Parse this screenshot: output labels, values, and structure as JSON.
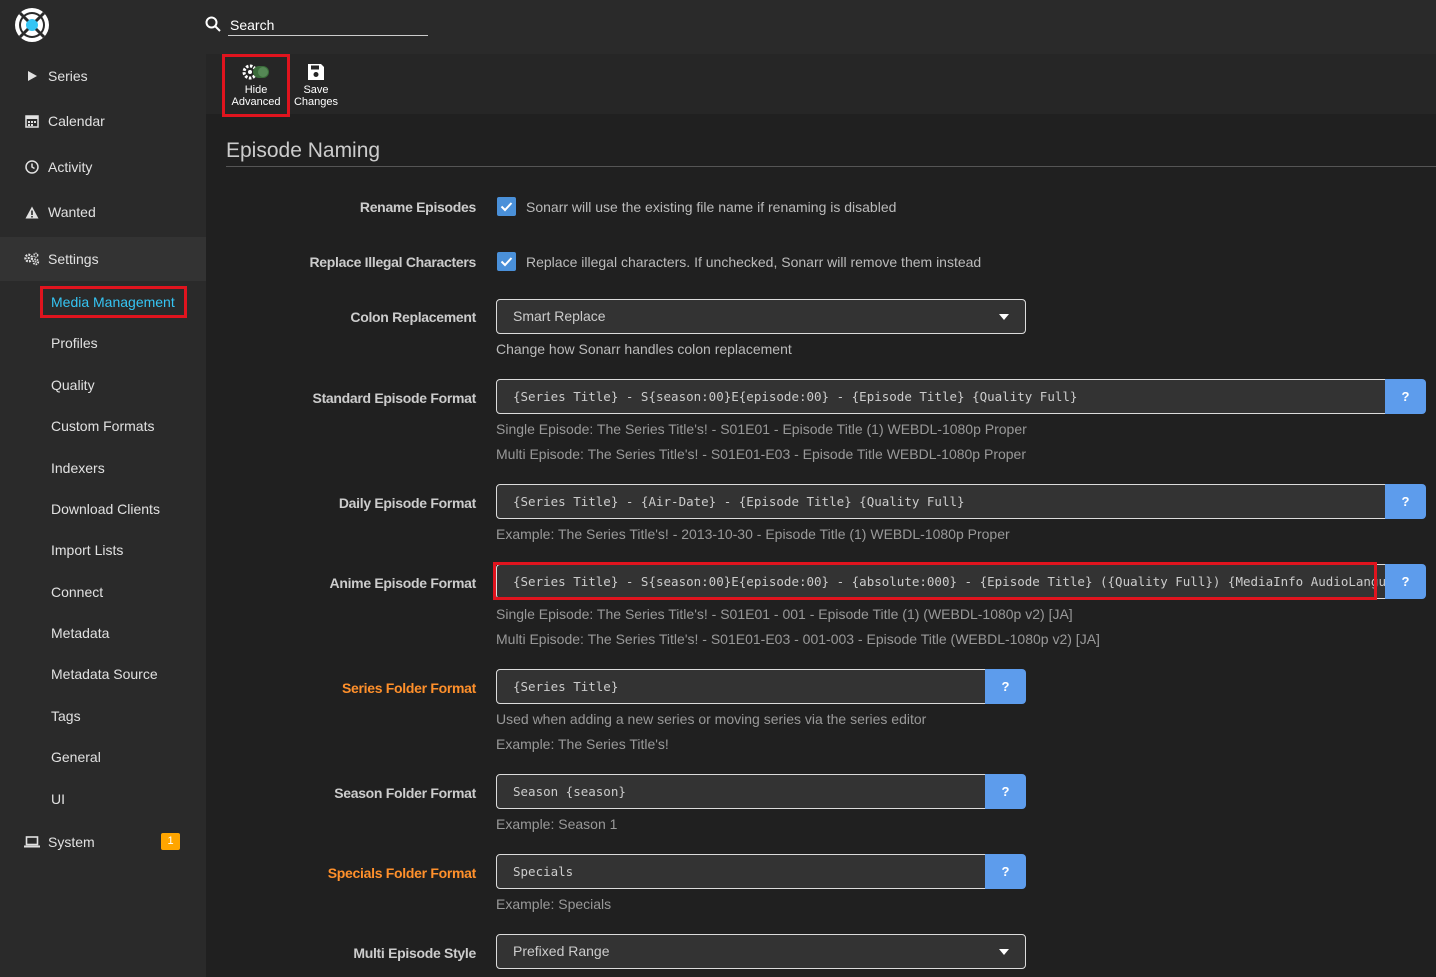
{
  "header": {
    "search_placeholder": "Search"
  },
  "sidebar": {
    "items": [
      {
        "label": "Series",
        "icon": "play-icon"
      },
      {
        "label": "Calendar",
        "icon": "calendar-icon"
      },
      {
        "label": "Activity",
        "icon": "clock-icon"
      },
      {
        "label": "Wanted",
        "icon": "warning-icon"
      },
      {
        "label": "Settings",
        "icon": "cogs-icon"
      },
      {
        "label": "System",
        "icon": "laptop-icon",
        "badge": "1"
      }
    ],
    "settings_subitems": [
      "Media Management",
      "Profiles",
      "Quality",
      "Custom Formats",
      "Indexers",
      "Download Clients",
      "Import Lists",
      "Connect",
      "Metadata",
      "Metadata Source",
      "Tags",
      "General",
      "UI"
    ],
    "active_subitem": "Media Management"
  },
  "toolbar": {
    "hide_advanced": [
      "Hide",
      "Advanced"
    ],
    "save_changes": [
      "Save",
      "Changes"
    ]
  },
  "content": {
    "section_title": "Episode Naming",
    "rename_episodes": {
      "label": "Rename Episodes",
      "checked": true,
      "help": "Sonarr will use the existing file name if renaming is disabled"
    },
    "replace_illegal": {
      "label": "Replace Illegal Characters",
      "checked": true,
      "help": "Replace illegal characters. If unchecked, Sonarr will remove them instead"
    },
    "colon_replacement": {
      "label": "Colon Replacement",
      "value": "Smart Replace",
      "help": "Change how Sonarr handles colon replacement"
    },
    "standard_format": {
      "label": "Standard Episode Format",
      "value": "{Series Title} - S{season:00}E{episode:00} - {Episode Title} {Quality Full}",
      "examples": [
        "Single Episode: The Series Title's! - S01E01 - Episode Title (1) WEBDL-1080p Proper",
        "Multi Episode: The Series Title's! - S01E01-E03 - Episode Title WEBDL-1080p Proper"
      ]
    },
    "daily_format": {
      "label": "Daily Episode Format",
      "value": "{Series Title} - {Air-Date} - {Episode Title} {Quality Full}",
      "examples": [
        "Example: The Series Title's! - 2013-10-30 - Episode Title (1) WEBDL-1080p Proper"
      ]
    },
    "anime_format": {
      "label": "Anime Episode Format",
      "value": "{Series Title} - S{season:00}E{episode:00} - {absolute:000} - {Episode Title} ({Quality Full}) {MediaInfo AudioLanguages}",
      "examples": [
        "Single Episode: The Series Title's! - S01E01 - 001 - Episode Title (1) (WEBDL-1080p v2) [JA]",
        "Multi Episode: The Series Title's! - S01E01-E03 - 001-003 - Episode Title (WEBDL-1080p v2) [JA]"
      ]
    },
    "series_folder": {
      "label": "Series Folder Format",
      "value": "{Series Title}",
      "help": "Used when adding a new series or moving series via the series editor",
      "example": "Example: The Series Title's!"
    },
    "season_folder": {
      "label": "Season Folder Format",
      "value": "Season {season}",
      "example": "Example: Season 1"
    },
    "specials_folder": {
      "label": "Specials Folder Format",
      "value": "Specials",
      "example": "Example: Specials"
    },
    "multi_episode_style": {
      "label": "Multi Episode Style",
      "value": "Prefixed Range"
    },
    "help_button": "?"
  },
  "colors": {
    "accent": "#35c5f4",
    "advanced_label": "#ff902b",
    "highlight": "#e0141e",
    "help_button": "#5d9cec",
    "badge": "#ffa500"
  }
}
